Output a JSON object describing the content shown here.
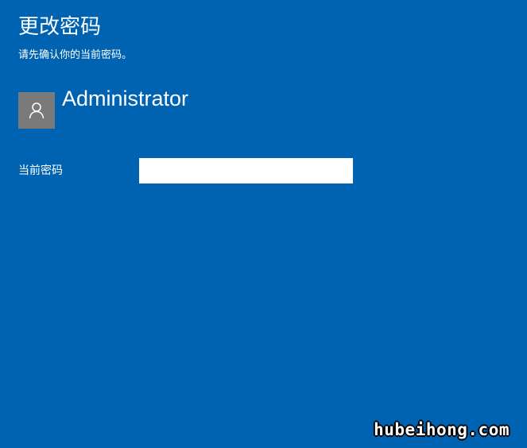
{
  "dialog": {
    "title": "更改密码",
    "subtitle": "请先确认你的当前密码。"
  },
  "user": {
    "avatar_icon": "person-icon",
    "name": "Administrator"
  },
  "form": {
    "current_password_label": "当前密码",
    "current_password_value": ""
  },
  "watermark": {
    "text": "hubeihong.com"
  },
  "colors": {
    "background": "#0063b1",
    "avatar_bg": "#7a7a7a",
    "text": "#ffffff"
  }
}
